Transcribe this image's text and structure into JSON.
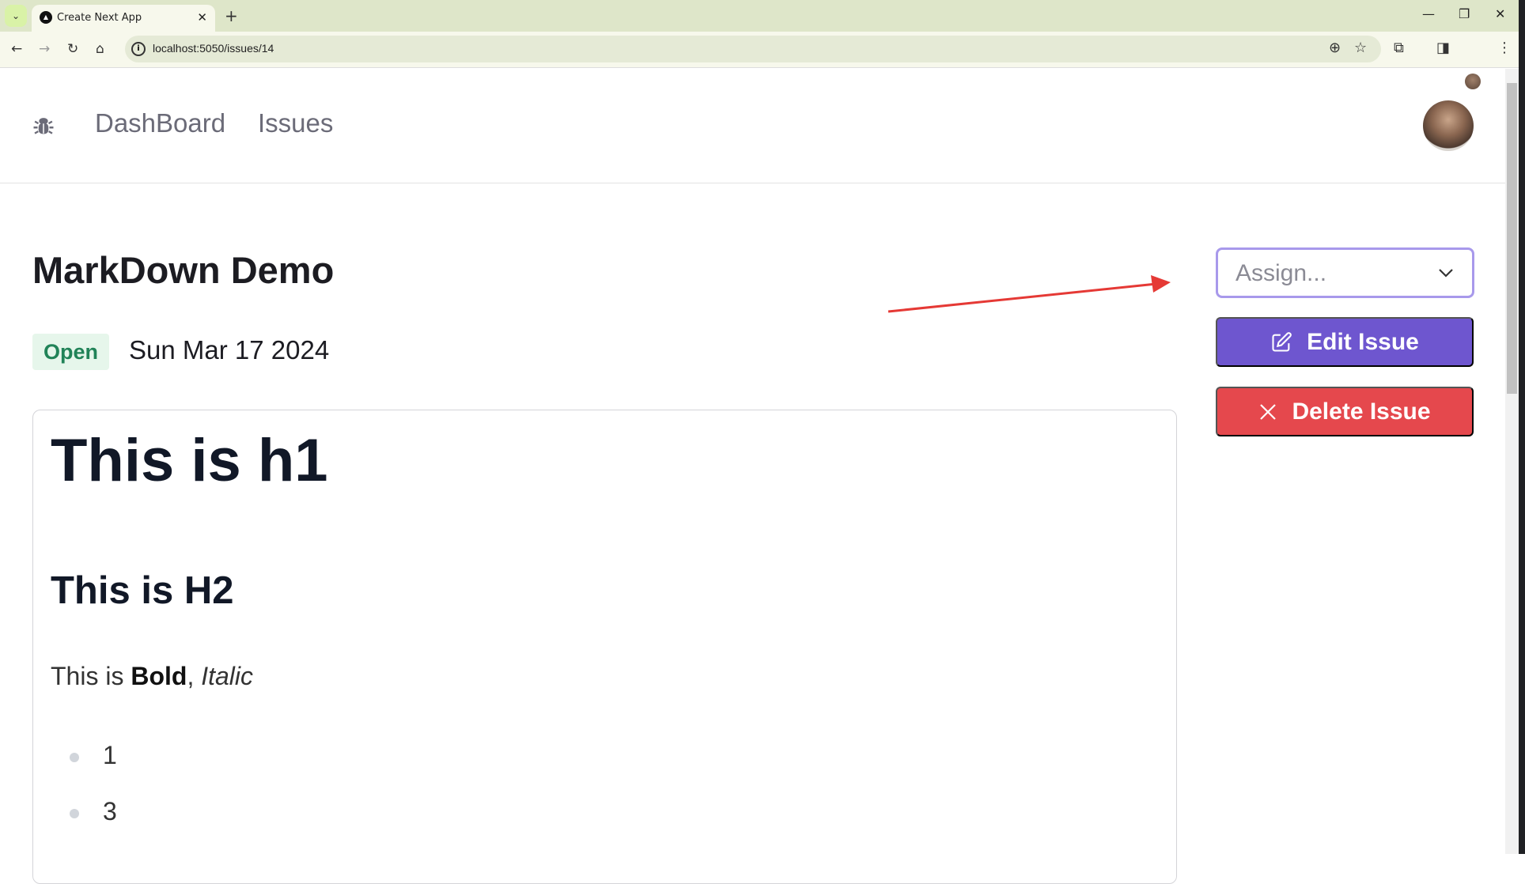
{
  "browser": {
    "tab_title": "Create Next App",
    "url": "localhost:5050/issues/14"
  },
  "nav": {
    "logo_icon": "bug-icon",
    "links": [
      {
        "label": "DashBoard"
      },
      {
        "label": "Issues"
      }
    ]
  },
  "issue": {
    "title": "MarkDown Demo",
    "status": "Open",
    "date": "Sun Mar 17 2024",
    "body": {
      "h1": "This is h1",
      "h2": "This is H2",
      "p_prefix": "This is ",
      "p_bold": "Bold",
      "p_sep": ", ",
      "p_italic": "Italic",
      "list": [
        "1",
        "3"
      ]
    }
  },
  "actions": {
    "assign_placeholder": "Assign...",
    "edit_label": "Edit Issue",
    "delete_label": "Delete Issue"
  },
  "colors": {
    "accent": "#6e56cf",
    "danger": "#e5484d",
    "open_badge_bg": "#e6f6eb",
    "open_badge_text": "#218358",
    "annotation_arrow": "#e53935"
  }
}
